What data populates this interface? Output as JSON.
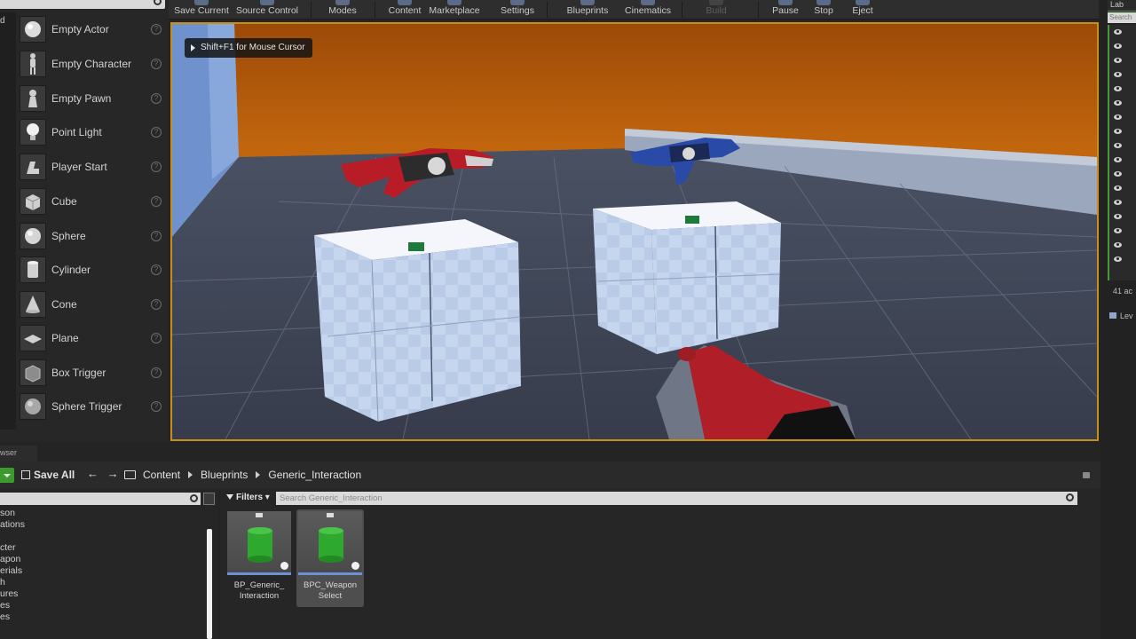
{
  "toolbar": {
    "buttons": [
      {
        "label": "Save Current",
        "disabled": false
      },
      {
        "label": "Source Control",
        "disabled": false
      },
      {
        "label": "Modes",
        "disabled": false
      },
      {
        "label": "Content",
        "disabled": false
      },
      {
        "label": "Marketplace",
        "disabled": false
      },
      {
        "label": "Settings",
        "disabled": false
      },
      {
        "label": "Blueprints",
        "disabled": false
      },
      {
        "label": "Cinematics",
        "disabled": false
      },
      {
        "label": "Build",
        "disabled": true
      },
      {
        "label": "Pause",
        "disabled": false
      },
      {
        "label": "Stop",
        "disabled": false
      },
      {
        "label": "Eject",
        "disabled": false
      }
    ]
  },
  "modes_panel": {
    "tab_label": "d",
    "info_glyph": "?",
    "items": [
      {
        "label": "Empty Actor",
        "icon": "sphere-icon"
      },
      {
        "label": "Empty Character",
        "icon": "character-icon"
      },
      {
        "label": "Empty Pawn",
        "icon": "pawn-icon"
      },
      {
        "label": "Point Light",
        "icon": "lightbulb-icon"
      },
      {
        "label": "Player Start",
        "icon": "player-start-icon"
      },
      {
        "label": "Cube",
        "icon": "cube-icon"
      },
      {
        "label": "Sphere",
        "icon": "sphere-icon"
      },
      {
        "label": "Cylinder",
        "icon": "cylinder-icon"
      },
      {
        "label": "Cone",
        "icon": "cone-icon"
      },
      {
        "label": "Plane",
        "icon": "plane-icon"
      },
      {
        "label": "Box Trigger",
        "icon": "box-trigger-icon"
      },
      {
        "label": "Sphere Trigger",
        "icon": "sphere-trigger-icon"
      }
    ]
  },
  "viewport": {
    "hint": "Shift+F1 for Mouse Cursor",
    "accent_color": "#c88f17"
  },
  "outliner": {
    "tab_label": "Lab",
    "search_placeholder": "Search",
    "actor_count": "41 ac",
    "levels_label": "Lev"
  },
  "content_browser": {
    "tab_label": "wser",
    "save_all": "Save All",
    "nav": "← →",
    "breadcrumb": [
      "Content",
      "Blueprints",
      "Generic_Interaction"
    ],
    "filters_label": "Filters",
    "search_placeholder": "Search Generic_Interaction",
    "tree_items": [
      "son",
      "ations",
      "cter",
      "apon",
      "erials",
      "h",
      "ures",
      "es",
      "es"
    ],
    "assets": [
      {
        "name": "BP_Generic_\nInteraction",
        "selected": false
      },
      {
        "name": "BPC_Weapon\nSelect",
        "selected": true
      }
    ]
  }
}
